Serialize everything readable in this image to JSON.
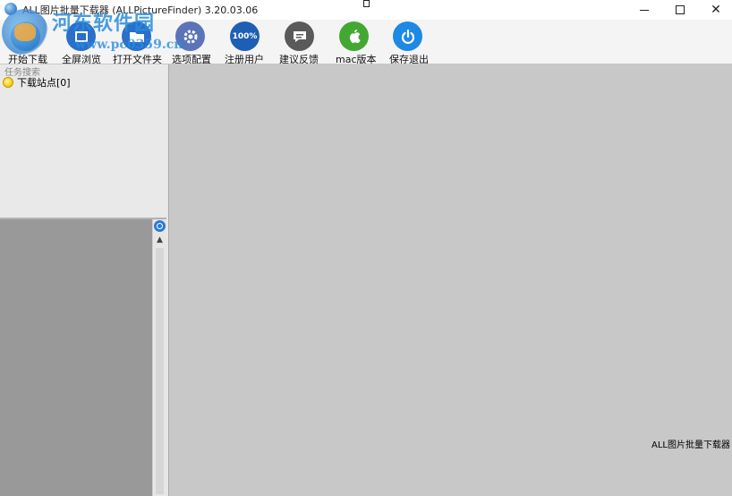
{
  "window": {
    "title": "ALL图片批量下载器 (ALLPictureFinder) 3.20.03.06",
    "controls": {
      "minimize": "",
      "maximize": "",
      "close": "✕"
    }
  },
  "watermark": {
    "title": "河东软件园",
    "url": "www.pc0359.cn"
  },
  "toolbar": {
    "items": [
      {
        "label": "开始下载",
        "icon": "download-icon",
        "color": "#3a8fd9"
      },
      {
        "label": "全屏浏览",
        "icon": "fullscreen-icon",
        "color": "#2a6fc9"
      },
      {
        "label": "打开文件夹",
        "icon": "folder-icon",
        "color": "#2a6fc9"
      },
      {
        "label": "选项配置",
        "icon": "gear-icon",
        "color": "#5b73b8"
      },
      {
        "label": "注册用户",
        "icon": "badge-100-icon",
        "color": "#1f5fb3",
        "text": "100%"
      },
      {
        "label": "建议反馈",
        "icon": "chat-bubble-icon",
        "color": "#5a5a5a"
      },
      {
        "label": "mac版本",
        "icon": "apple-icon",
        "color": "#43a832"
      },
      {
        "label": "保存退出",
        "icon": "power-icon",
        "color": "#1e88e5"
      }
    ]
  },
  "left_panel": {
    "search_label": "任务搜索",
    "tree": [
      {
        "label": "下载站点[0]",
        "icon": "bulb-icon"
      }
    ]
  },
  "main": {
    "caption": "ALL图片批量下载器"
  },
  "colors": {
    "main_bg": "#c8c8c8",
    "left_bottom_bg": "#999999",
    "left_top_bg": "#e9e9e9"
  }
}
